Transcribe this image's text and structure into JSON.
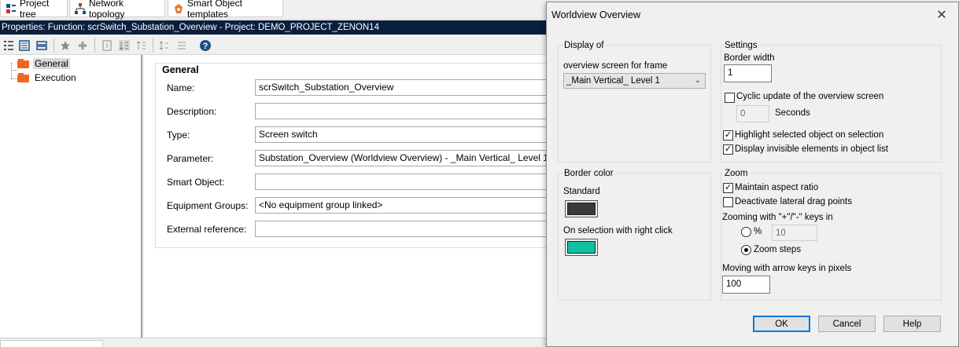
{
  "tabs": [
    {
      "label": "Project tree",
      "icon": "project-tree-icon"
    },
    {
      "label": "Network topology",
      "icon": "network-icon"
    },
    {
      "label": "Smart Object templates",
      "icon": "smart-object-icon"
    }
  ],
  "properties_title": "Properties: Function: scrSwitch_Substation_Overview - Project: DEMO_PROJECT_ZENON14",
  "tree": {
    "items": [
      {
        "label": "General",
        "selected": true
      },
      {
        "label": "Execution",
        "selected": false
      }
    ]
  },
  "general": {
    "title": "General",
    "rows": [
      {
        "label": "Name:",
        "value": "scrSwitch_Substation_Overview"
      },
      {
        "label": "Description:",
        "value": ""
      },
      {
        "label": "Type:",
        "value": "Screen switch"
      },
      {
        "label": "Parameter:",
        "value": "Substation_Overview (Worldview Overview) - _Main Vertical_ Level 1"
      },
      {
        "label": "Smart Object:",
        "value": ""
      },
      {
        "label": "Equipment Groups:",
        "value": "<No equipment group linked>"
      },
      {
        "label": "External reference:",
        "value": ""
      }
    ]
  },
  "dialog": {
    "title": "Worldview Overview",
    "close_icon": "close-icon",
    "display_of": {
      "title": "Display of",
      "label": "overview screen for frame",
      "selected": "_Main Vertical_ Level 1"
    },
    "settings": {
      "title": "Settings",
      "border_width_label": "Border width",
      "border_width_value": "1",
      "cyclic_update_label": "Cyclic update of the overview screen",
      "cyclic_update_checked": false,
      "seconds_value": "0",
      "seconds_label": "Seconds",
      "highlight_label": "Highlight selected object on selection",
      "highlight_checked": true,
      "invisible_label": "Display invisible elements in object list",
      "invisible_checked": true
    },
    "border_color": {
      "title": "Border color",
      "standard_label": "Standard",
      "standard_color": "#3a3a3a",
      "selection_label": "On selection with right click",
      "selection_color": "#10c0a0"
    },
    "zoom": {
      "title": "Zoom",
      "aspect_label": "Maintain aspect ratio",
      "aspect_checked": true,
      "lateral_label": "Deactivate lateral drag points",
      "lateral_checked": false,
      "keys_label": "Zooming with \"+\"/\"-\" keys in",
      "percent_label": "%",
      "percent_value": "10",
      "steps_label": "Zoom steps",
      "selected_mode": "Zoom steps",
      "arrow_label": "Moving with arrow keys in pixels",
      "arrow_value": "100"
    },
    "buttons": {
      "ok": "OK",
      "cancel": "Cancel",
      "help": "Help"
    }
  }
}
